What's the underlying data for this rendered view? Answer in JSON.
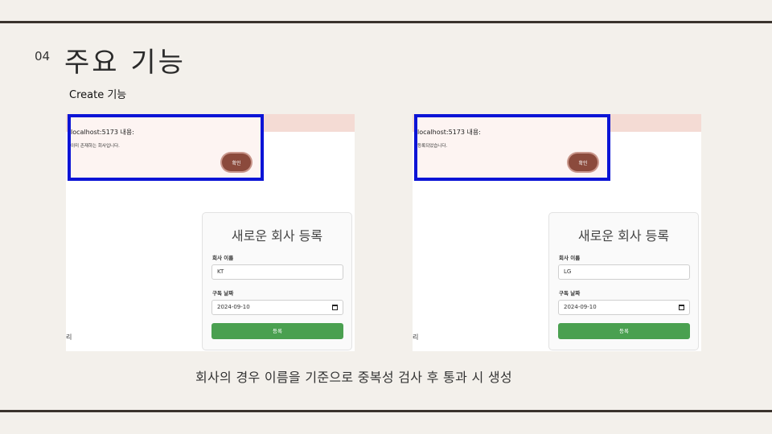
{
  "slide": {
    "section_number": "04",
    "title": "주요 기능",
    "subtitle": "Create 기능",
    "caption": "회사의 경우 이름을 기준으로 중복성 검사 후 통과 시 생성"
  },
  "screenshots": [
    {
      "dialog": {
        "title": "localhost:5173 내용:",
        "message": "이미 존재하는 회사입니다.",
        "ok_label": "확인"
      },
      "side_text": "리",
      "form": {
        "title": "새로운 회사 등록",
        "name_label": "회사 이름",
        "name_value": "KT",
        "date_label": "구독 날짜",
        "date_value": "2024-09-10",
        "submit_label": "등록"
      }
    },
    {
      "dialog": {
        "title": "localhost:5173 내용:",
        "message": "등록되었습니다.",
        "ok_label": "확인"
      },
      "side_text": "리",
      "form": {
        "title": "새로운 회사 등록",
        "name_label": "회사 이름",
        "name_value": "LG",
        "date_label": "구독 날짜",
        "date_value": "2024-09-10",
        "submit_label": "등록"
      }
    }
  ],
  "colors": {
    "highlight_border": "#0b14d6",
    "ok_button": "#8b4a3c",
    "submit_button": "#4aa050",
    "rule": "#3a332d"
  }
}
